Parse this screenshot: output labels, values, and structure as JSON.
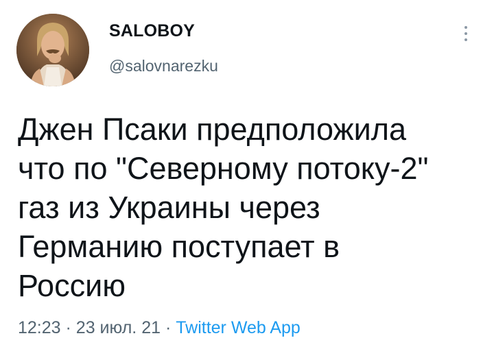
{
  "author": {
    "display_name": "SALOBOY",
    "handle": "@salovnarezku",
    "avatar_icon": "user-avatar-photo"
  },
  "tweet": {
    "text_lines": [
      "Джен Псаки предположила",
      "что по \"Северному потоку-2\"",
      "газ из Украины через",
      "Германию поступает в",
      "Россию"
    ]
  },
  "meta": {
    "time": "12:23",
    "separator": "·",
    "date": "23 июл. 21",
    "source": "Twitter Web App"
  },
  "colors": {
    "text": "#0f1419",
    "secondary": "#536471",
    "link": "#1d9bf0",
    "more_icon": "#8b98a5"
  },
  "icons": {
    "more": "more-vertical-icon"
  }
}
